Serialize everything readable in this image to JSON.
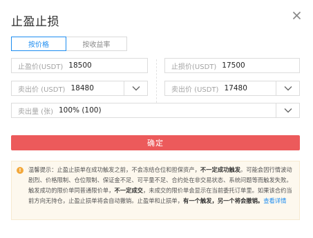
{
  "dialog": {
    "title": "止盈止损",
    "close_icon": "close-icon"
  },
  "tabs": [
    {
      "label": "按价格",
      "active": true
    },
    {
      "label": "按收益率",
      "active": false
    }
  ],
  "fields": {
    "take_profit_trigger": {
      "label": "止盈价(USDT)",
      "value": "18500"
    },
    "stop_loss_trigger": {
      "label": "止损价(USDT)",
      "value": "17500"
    },
    "take_profit_sell": {
      "label": "卖出价 (USDT)",
      "value": "18480",
      "icon": "chevron-down-icon"
    },
    "stop_loss_sell": {
      "label": "卖出价 (USDT)",
      "value": "17480",
      "icon": "chevron-down-icon"
    },
    "sell_amount": {
      "label": "卖出量 (张)",
      "value": "100% (100)",
      "icon": "chevron-down-icon"
    }
  },
  "confirm_button": {
    "label": "确定",
    "color": "#ec5a5b"
  },
  "notice": {
    "icon": "warning-icon",
    "segments": [
      {
        "text": "温馨提示：止盈止损单在成功触发之前，不会冻结仓位和担保资产，",
        "style": "normal"
      },
      {
        "text": "不一定成功触发",
        "style": "bold"
      },
      {
        "text": "。可能会因行情波动剧烈、价格限制、仓位限制、保证金不足、可平量不足、合约处在非交易状态、系统问题等而触发失败。触发成功的限价单同普通限价单，",
        "style": "normal"
      },
      {
        "text": "不一定成交",
        "style": "bold"
      },
      {
        "text": "，未成交的限价单会显示在当前委托订单里。如果该合约当前方向无持仓，止盈止损单将会自动撤销。止盈单和止损单，",
        "style": "normal"
      },
      {
        "text": "有一个触发，另一个将会撤销。",
        "style": "bold"
      },
      {
        "text": "查看详情",
        "style": "link"
      }
    ]
  },
  "colors": {
    "accent": "#1c8cf0",
    "confirm": "#ec5a5b",
    "warning": "#f3a83b",
    "notice_bg": "#fdf8ee"
  }
}
